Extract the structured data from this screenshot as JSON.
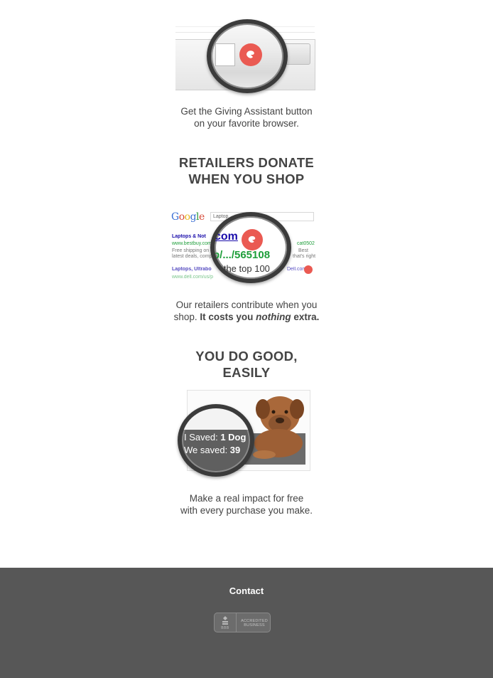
{
  "section1": {
    "caption_line1": "Get the Giving Assistant button",
    "caption_line2": "on your favorite browser."
  },
  "section2": {
    "heading_line1": "RETAILERS DONATE",
    "heading_line2": "WHEN YOU SHOP",
    "serp": {
      "logo_text": "Google",
      "search_text": "Laptop",
      "result1_title": "Laptops & Not",
      "result1_url": "www.bestbuy.com",
      "result1_url_tail": "cat0502",
      "result1_snippet_a": "Free shipping on P",
      "result1_snippet_a_tail": "Best",
      "result1_snippet_b": "latest deals, compa",
      "result1_snippet_b_tail": "that's right",
      "result2_title": "Laptops, Ultrabo",
      "result2_title_tail": "Dell.com",
      "result2_url": "www.dell.com/us/p",
      "lens_line1": "com",
      "lens_line2": "p/.../565108",
      "lens_line3": "d the top 100"
    },
    "caption_line1": "Our retailers contribute when you",
    "caption_line2_start": "shop. ",
    "caption_line2_bold": "It costs you ",
    "caption_line2_italic": "nothing",
    "caption_line2_end": " extra."
  },
  "section3": {
    "heading_line1": "YOU DO GOOD,",
    "heading_line2": "EASILY",
    "lens_saved_label_1": "I Saved: ",
    "lens_saved_value_1": "1 Dog",
    "lens_saved_label_2": "We saved: ",
    "lens_saved_value_2": "39",
    "caption_line1": "Make a real impact for free",
    "caption_line2": "with every purchase you make."
  },
  "footer": {
    "contact_label": "Contact",
    "bbb_small": "BBB",
    "bbb_line1": "ACCREDITED",
    "bbb_line2": "BUSINESS"
  },
  "colors": {
    "brand_red": "#ea5a52",
    "footer_bg": "#575757",
    "link_blue": "#1a0dab",
    "url_green": "#1e9e3a"
  },
  "icons": {
    "browser_button": "giving-assistant-logo-icon",
    "bbb_seal": "bbb-torch-icon"
  }
}
